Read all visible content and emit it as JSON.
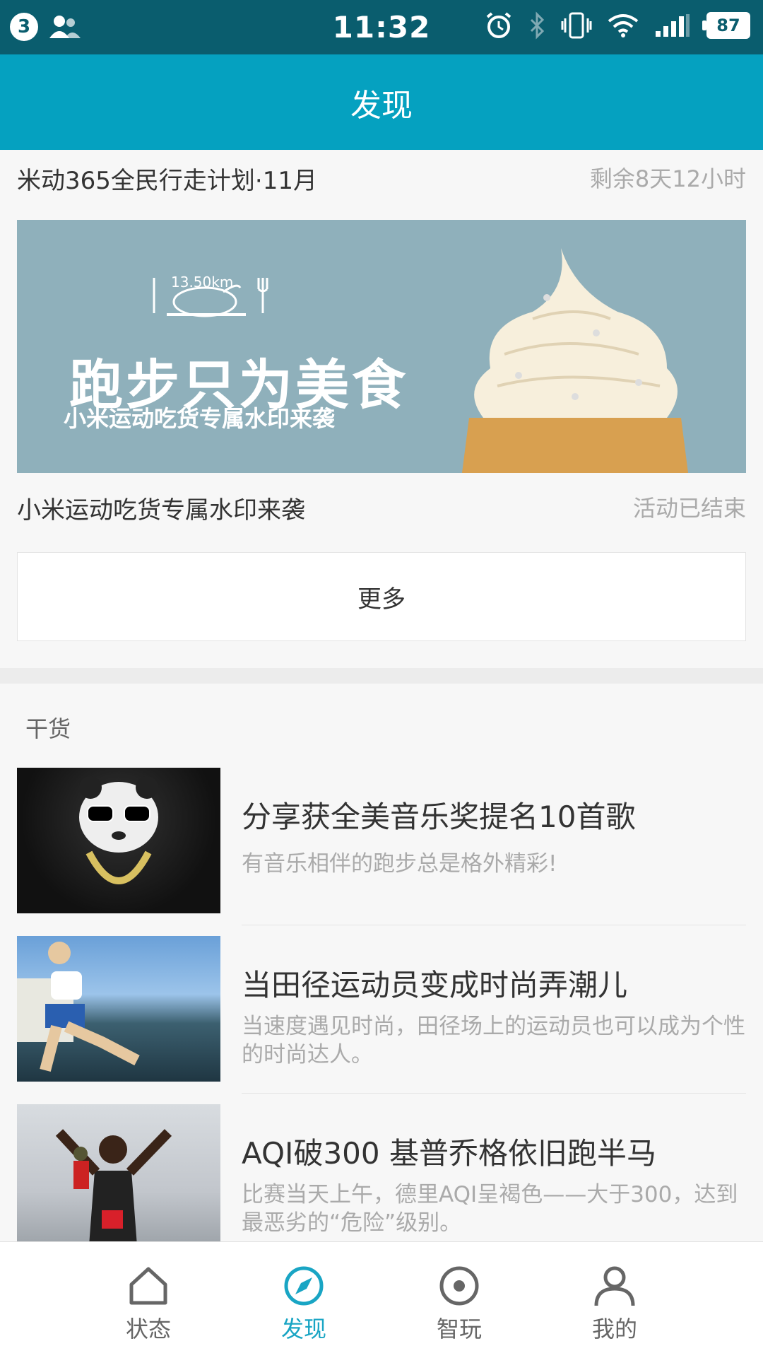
{
  "status_bar": {
    "notification_count": "3",
    "time": "11:32",
    "battery": "87",
    "icons": [
      "notification-badge-icon",
      "contacts-icon",
      "alarm-icon",
      "bluetooth-icon",
      "vibrate-icon",
      "wifi-icon",
      "signal-icon",
      "battery-icon"
    ]
  },
  "header": {
    "title": "发现"
  },
  "challenge": {
    "title": "米动365全民行走计划·11月",
    "remaining": "剩余8天12小时"
  },
  "banner": {
    "distance": "13.50km",
    "headline": "跑步只为美食",
    "subline": "小米运动吃货专属水印来袭"
  },
  "activity": {
    "name": "小米运动吃货专属水印来袭",
    "status": "活动已结束"
  },
  "more_button": {
    "label": "更多"
  },
  "section": {
    "label": "干货"
  },
  "articles": [
    {
      "title": "分享获全美音乐奖提名10首歌",
      "desc": "有音乐相伴的跑步总是格外精彩!"
    },
    {
      "title": "当田径运动员变成时尚弄潮儿",
      "desc": "当速度遇见时尚，田径场上的运动员也可以成为个性的时尚达人。"
    },
    {
      "title": "AQI破300 基普乔格依旧跑半马",
      "desc": "比赛当天上午，德里AQI呈褐色——大于300，达到最恶劣的“危险”级别。"
    }
  ],
  "bottom_nav": [
    {
      "label": "状态",
      "icon": "home-icon"
    },
    {
      "label": "发现",
      "icon": "compass-icon",
      "active": true
    },
    {
      "label": "智玩",
      "icon": "target-icon"
    },
    {
      "label": "我的",
      "icon": "person-icon"
    }
  ],
  "colors": {
    "status_bar": "#0a5d6e",
    "header": "#05a1c0",
    "accent": "#19a5c4",
    "inactive_nav": "#666666",
    "muted_text": "#aaaaaa"
  }
}
